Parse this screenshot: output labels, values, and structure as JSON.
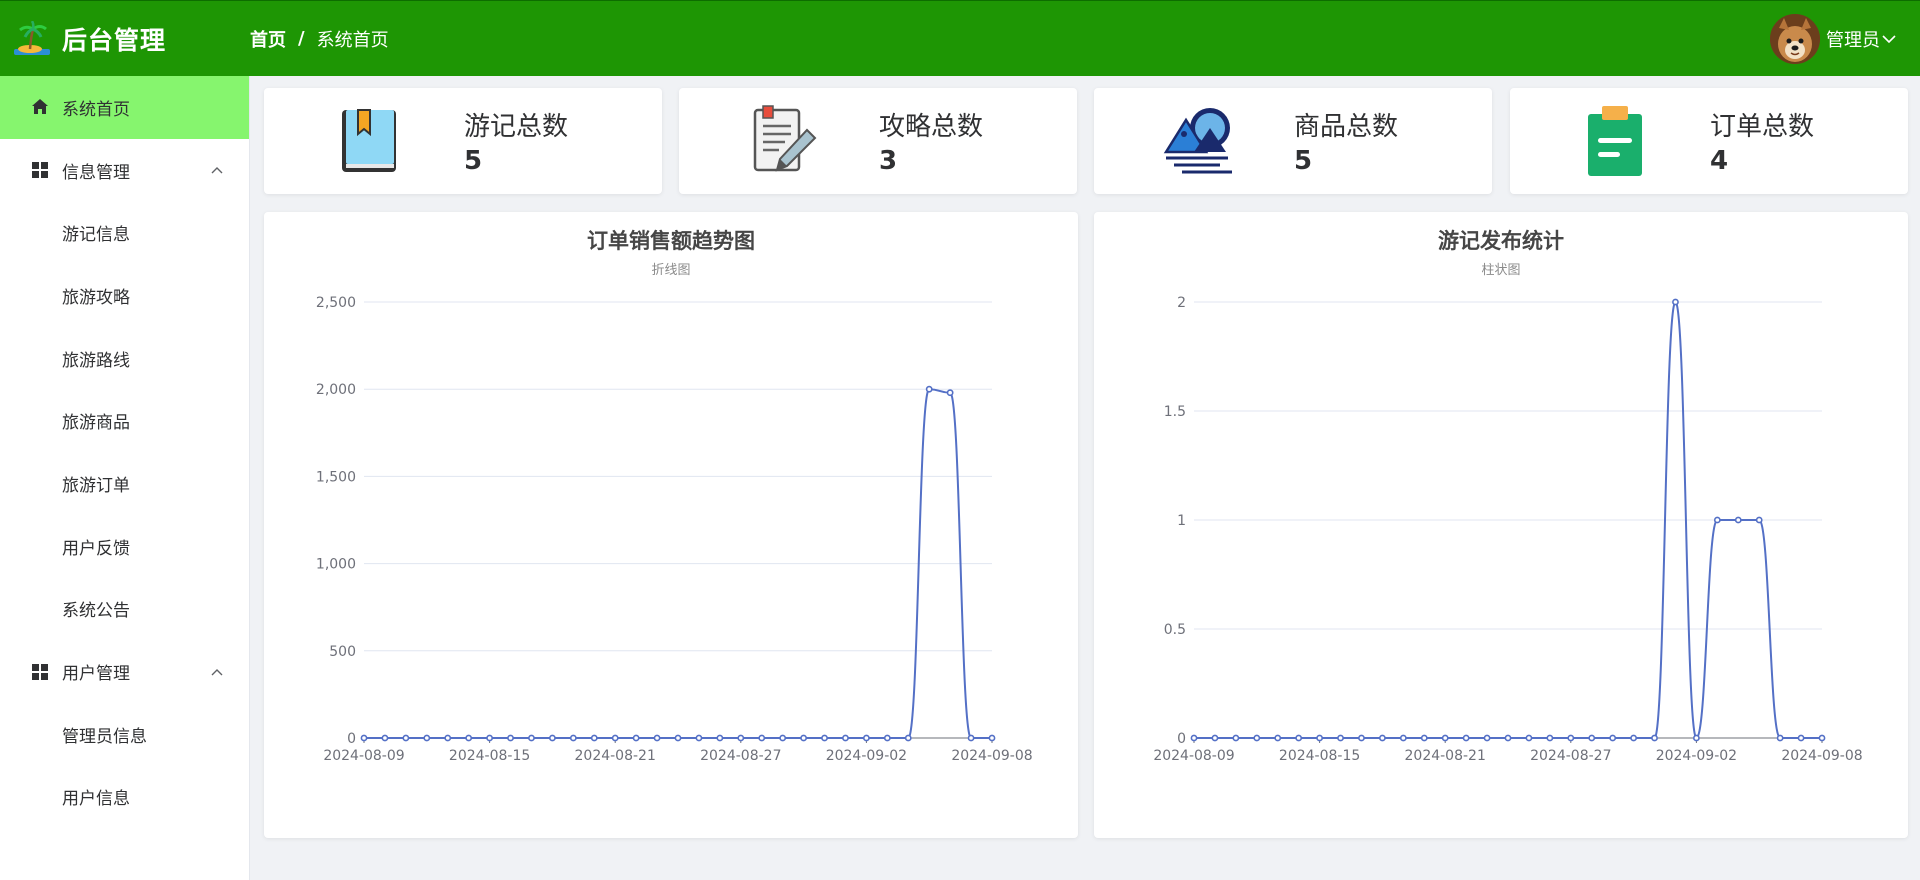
{
  "header": {
    "app_title": "后台管理",
    "breadcrumb_home": "首页",
    "breadcrumb_sep": "/",
    "breadcrumb_current": "系统首页",
    "user_label": "管理员",
    "brand_color": "#1e9604"
  },
  "sidebar": {
    "items": [
      {
        "label": "系统首页",
        "icon": "home-icon",
        "active": true,
        "type": "top"
      },
      {
        "label": "信息管理",
        "icon": "grid-icon",
        "type": "group"
      },
      {
        "label": "游记信息",
        "type": "sub"
      },
      {
        "label": "旅游攻略",
        "type": "sub"
      },
      {
        "label": "旅游路线",
        "type": "sub"
      },
      {
        "label": "旅游商品",
        "type": "sub"
      },
      {
        "label": "旅游订单",
        "type": "sub"
      },
      {
        "label": "用户反馈",
        "type": "sub"
      },
      {
        "label": "系统公告",
        "type": "sub"
      },
      {
        "label": "用户管理",
        "icon": "grid-icon",
        "type": "group"
      },
      {
        "label": "管理员信息",
        "type": "sub"
      },
      {
        "label": "用户信息",
        "type": "sub"
      }
    ],
    "active_color": "#86f56e"
  },
  "stats": [
    {
      "label": "游记总数",
      "value": "5",
      "icon": "book-icon"
    },
    {
      "label": "攻略总数",
      "value": "3",
      "icon": "notepad-pen-icon"
    },
    {
      "label": "商品总数",
      "value": "5",
      "icon": "landscape-icon"
    },
    {
      "label": "订单总数",
      "value": "4",
      "icon": "clipboard-icon"
    }
  ],
  "chart_data": [
    {
      "type": "line",
      "title": "订单销售额趋势图",
      "subtitle": "折线图",
      "x_start": "2024-08-09",
      "x_end": "2024-09-08",
      "x_tick_labels": [
        "2024-08-09",
        "2024-08-15",
        "2024-08-21",
        "2024-08-27",
        "2024-09-02",
        "2024-09-08"
      ],
      "y_tick_labels": [
        "0",
        "500",
        "1,000",
        "1,500",
        "2,000",
        "2,500"
      ],
      "ylim": [
        0,
        2500
      ],
      "values": [
        0,
        0,
        0,
        0,
        0,
        0,
        0,
        0,
        0,
        0,
        0,
        0,
        0,
        0,
        0,
        0,
        0,
        0,
        0,
        0,
        0,
        0,
        0,
        0,
        0,
        0,
        0,
        2000,
        1980,
        0,
        0
      ],
      "color": "#5470c6",
      "grid": true
    },
    {
      "type": "line",
      "title": "游记发布统计",
      "subtitle": "柱状图",
      "x_start": "2024-08-09",
      "x_end": "2024-09-08",
      "x_tick_labels": [
        "2024-08-09",
        "2024-08-15",
        "2024-08-21",
        "2024-08-27",
        "2024-09-02",
        "2024-09-08"
      ],
      "y_tick_labels": [
        "0",
        "0.5",
        "1",
        "1.5",
        "2"
      ],
      "ylim": [
        0,
        2
      ],
      "values": [
        0,
        0,
        0,
        0,
        0,
        0,
        0,
        0,
        0,
        0,
        0,
        0,
        0,
        0,
        0,
        0,
        0,
        0,
        0,
        0,
        0,
        0,
        0,
        2,
        0,
        1,
        1,
        1,
        0,
        0,
        0
      ],
      "color": "#5470c6",
      "grid": true
    }
  ]
}
